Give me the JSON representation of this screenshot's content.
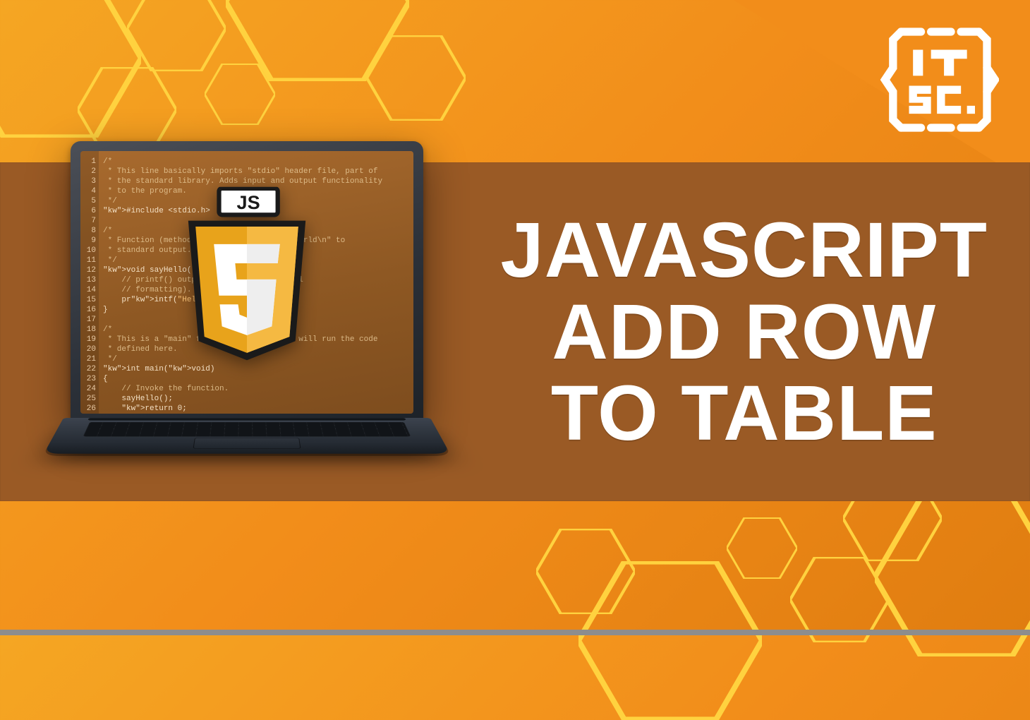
{
  "title": {
    "line1": "JAVASCRIPT",
    "line2": "ADD ROW",
    "line3": "TO TABLE"
  },
  "logo": {
    "name": "ITSC"
  },
  "js_badge": {
    "label": "JS",
    "glyph": "5"
  },
  "code": {
    "lines": [
      "/*",
      " * This line basically imports \"stdio\" header file, part of",
      " * the standard library. Adds input and output functionality",
      " * to the program.",
      " */",
      "#include <stdio.h>",
      "",
      "/*",
      " * Function (method) that prints \"Hello, world\\n\" to",
      " * standard output.",
      " */",
      "void sayHello() {",
      "    // printf() outputs text (with optional",
      "    // formatting).",
      "    printf(\"Hello, world\\n\");",
      "}",
      "",
      "/*",
      " * This is a \"main\" function; the program will run the code",
      " * defined here.",
      " */",
      "int main(void)",
      "{",
      "    // Invoke the function.",
      "    sayHello();",
      "    return 0;",
      "}"
    ]
  }
}
